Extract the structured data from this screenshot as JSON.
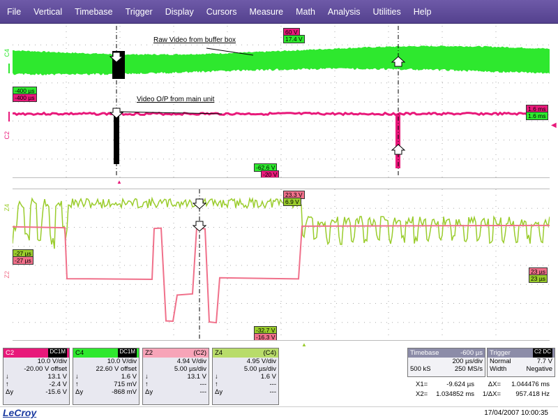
{
  "menu": [
    "File",
    "Vertical",
    "Timebase",
    "Trigger",
    "Display",
    "Cursors",
    "Measure",
    "Math",
    "Analysis",
    "Utilities",
    "Help"
  ],
  "colors": {
    "c2": "#e8197a",
    "c4": "#2ee82e",
    "z2": "#f0708a",
    "z4": "#9acc2c"
  },
  "grid1": {
    "label_c4": "C4",
    "label_c2": "C2",
    "note_raw": "Raw Video from buffer box",
    "note_out": "Video O/P from main unit",
    "tags": {
      "top_pink": "60 V",
      "top_green": "17.4 V",
      "left_green": "-400 µs",
      "left_pink": "-400 µs",
      "right_pink": "1.6 ms",
      "right_green": "1.6 ms",
      "bottom_green": "-62.6 V",
      "bottom_pink": "-20 V"
    }
  },
  "grid2": {
    "label_z4": "Z4",
    "label_z2": "Z2",
    "tags": {
      "top_rose": "23.3 V",
      "top_lime": "6.9 V",
      "left_lime": "-27 µs",
      "left_rose": "-27 µs",
      "right_rose": "23 µs",
      "right_lime": "23 µs",
      "bottom_lime": "-32.7 V",
      "bottom_rose": "-16.3 V"
    }
  },
  "descriptors": {
    "c2": {
      "name": "C2",
      "badge": "DC1M",
      "vdiv": "10.0 V/div",
      "offset": "-20.00 V offset",
      "r1l": "↓",
      "r1": "13.1 V",
      "r2l": "↑",
      "r2": "-2.4 V",
      "r3l": "Δy",
      "r3": "-15.6 V"
    },
    "c4": {
      "name": "C4",
      "badge": "DC1M",
      "vdiv": "10.0 V/div",
      "offset": "22.60 V offset",
      "r1l": "↓",
      "r1": "1.6 V",
      "r2l": "↑",
      "r2": "715 mV",
      "r3l": "Δy",
      "r3": "-868 mV"
    },
    "z2": {
      "name": "Z2",
      "src": "(C2)",
      "vdiv": "4.94 V/div",
      "offset": "5.00 µs/div",
      "r1l": "↓",
      "r1": "13.1 V",
      "r2l": "↑",
      "r2": "---",
      "r3l": "Δy",
      "r3": "---"
    },
    "z4": {
      "name": "Z4",
      "src": "(C4)",
      "vdiv": "4.95 V/div",
      "offset": "5.00 µs/div",
      "r1l": "↓",
      "r1": "1.6 V",
      "r2l": "↑",
      "r2": "---",
      "r3l": "Δy",
      "r3": "---"
    }
  },
  "timebase": {
    "title": "Timebase",
    "delay": "-600 µs",
    "div": "200 µs/div",
    "samples": "500 kS",
    "rate": "250 MS/s"
  },
  "trigger": {
    "title": "Trigger",
    "badge": "C2 DC",
    "mode": "Normal",
    "level": "7.7 V",
    "width_label": "Width",
    "slope": "Negative"
  },
  "cursors": {
    "x1_label": "X1=",
    "x1": "-9.624 µs",
    "dx_label": "ΔX=",
    "dx": "1.044476 ms",
    "x2_label": "X2=",
    "x2": "1.034852 ms",
    "inv_label": "1/ΔX=",
    "inv": "957.418 Hz"
  },
  "status": {
    "logo": "LeCroy",
    "datetime": "17/04/2007 10:00:35"
  }
}
